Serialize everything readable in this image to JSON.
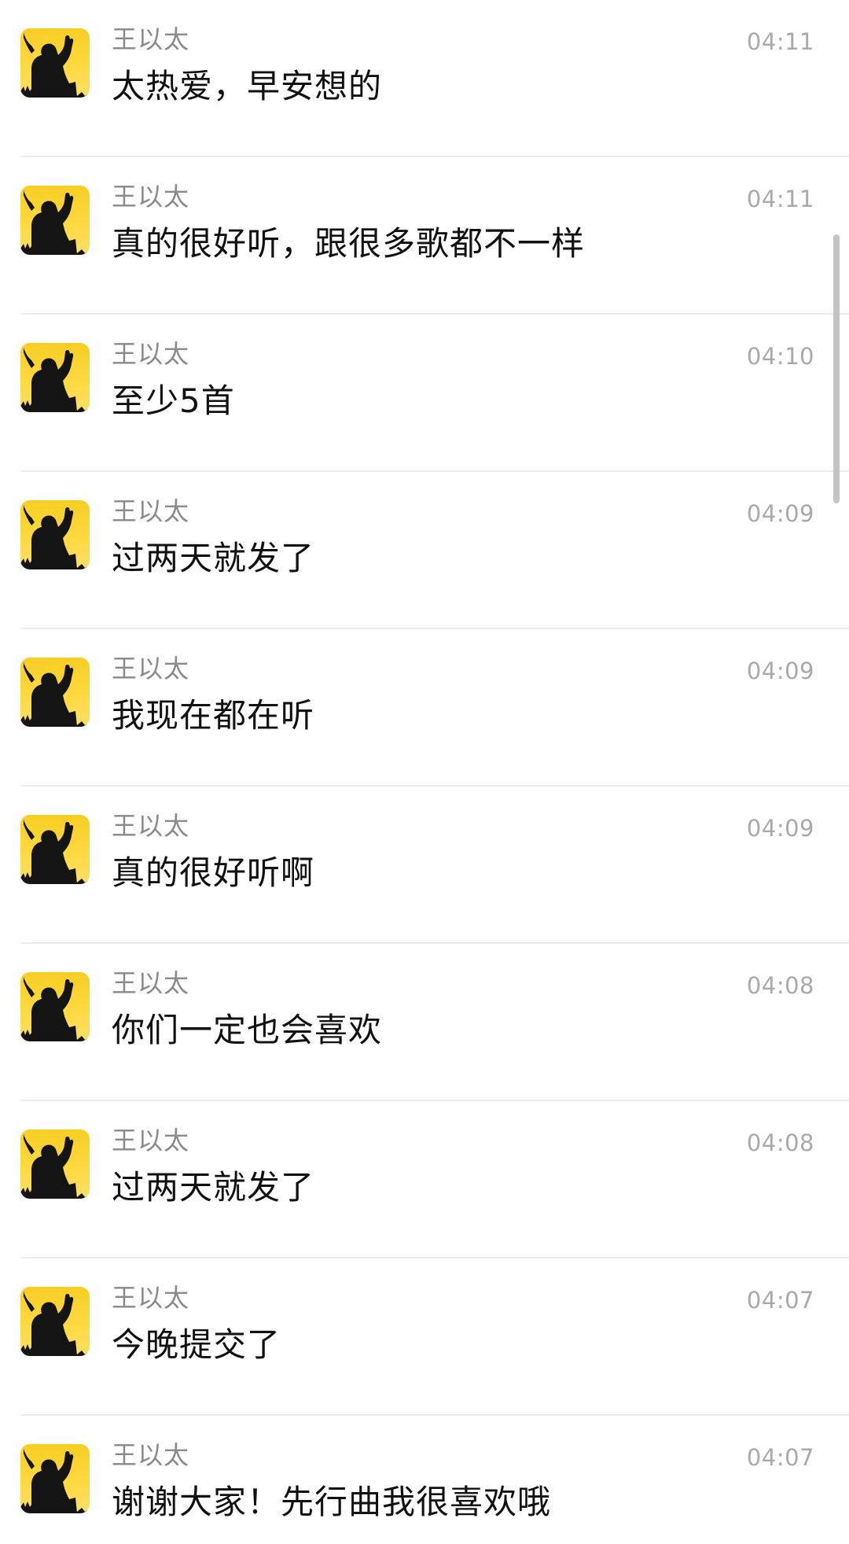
{
  "messages": [
    {
      "sender": "王以太",
      "time": "04:11",
      "text": "太热爱，早安想的"
    },
    {
      "sender": "王以太",
      "time": "04:11",
      "text": "真的很好听，跟很多歌都不一样"
    },
    {
      "sender": "王以太",
      "time": "04:10",
      "text": "至少5首"
    },
    {
      "sender": "王以太",
      "time": "04:09",
      "text": "过两天就发了"
    },
    {
      "sender": "王以太",
      "time": "04:09",
      "text": "我现在都在听"
    },
    {
      "sender": "王以太",
      "time": "04:09",
      "text": "真的很好听啊"
    },
    {
      "sender": "王以太",
      "time": "04:08",
      "text": "你们一定也会喜欢"
    },
    {
      "sender": "王以太",
      "time": "04:08",
      "text": "过两天就发了"
    },
    {
      "sender": "王以太",
      "time": "04:07",
      "text": "今晚提交了"
    },
    {
      "sender": "王以太",
      "time": "04:07",
      "text": "谢谢大家！先行曲我很喜欢哦"
    }
  ],
  "avatar_icon": "silhouette-raised-fist-avatar",
  "colors": {
    "avatar_bg": "#f7ce23",
    "name_text": "#8a8a8a",
    "time_text": "#a9a9a9",
    "message_text": "#111111",
    "divider": "#ececec"
  }
}
